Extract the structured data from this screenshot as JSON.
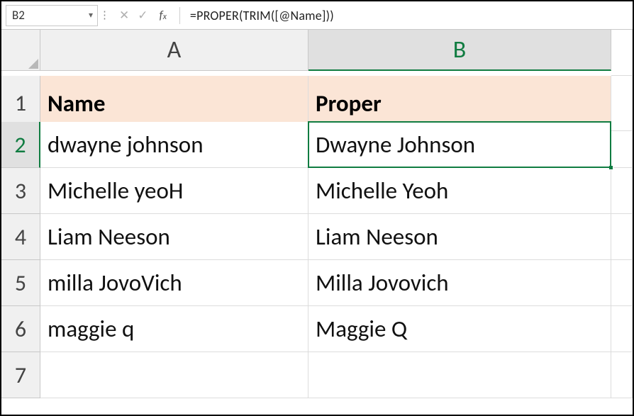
{
  "name_box": {
    "value": "B2"
  },
  "formula_bar": {
    "text": "=PROPER(TRIM([@Name]))"
  },
  "columns": [
    "A",
    "B"
  ],
  "active_column_index": 1,
  "active_row_index": 1,
  "rows": [
    {
      "n": "1",
      "a": "Name",
      "b": "Proper",
      "header": true
    },
    {
      "n": "2",
      "a": "dwayne johnson",
      "b": "Dwayne Johnson",
      "selected": true
    },
    {
      "n": "3",
      "a": "Michelle yeoH",
      "b": "Michelle Yeoh"
    },
    {
      "n": "4",
      "a": "Liam Neeson",
      "b": "Liam Neeson"
    },
    {
      "n": "5",
      "a": " milla JovoVich",
      "b": "Milla Jovovich"
    },
    {
      "n": "6",
      "a": "maggie q",
      "b": "Maggie Q"
    },
    {
      "n": "7",
      "a": "",
      "b": ""
    }
  ],
  "chart_data": {
    "type": "table",
    "columns": [
      "Name",
      "Proper"
    ],
    "rows": [
      [
        "dwayne johnson",
        "Dwayne Johnson"
      ],
      [
        "Michelle yeoH",
        "Michelle Yeoh"
      ],
      [
        "Liam Neeson",
        "Liam Neeson"
      ],
      [
        " milla JovoVich",
        "Milla Jovovich"
      ],
      [
        "maggie q",
        "Maggie Q"
      ]
    ]
  }
}
